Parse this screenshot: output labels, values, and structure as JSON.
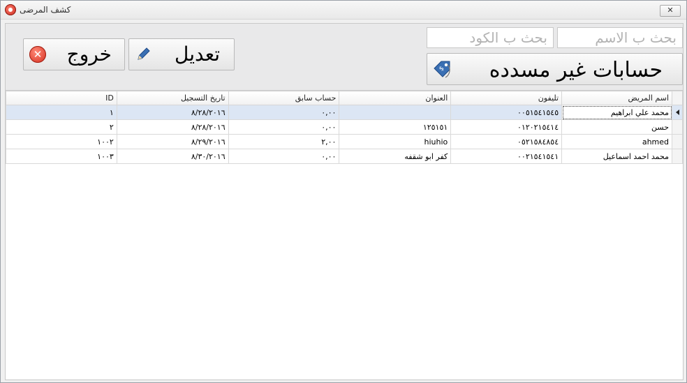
{
  "window": {
    "title": "كشف المرضى",
    "close_label": "✕"
  },
  "search": {
    "name_placeholder": "بحث ب الاسم",
    "code_placeholder": "بحث ب الكود"
  },
  "buttons": {
    "unpaid_label": "حسابات غير مسدده",
    "edit_label": "تعديل",
    "exit_label": "خروج",
    "exit_icon_glyph": "✕"
  },
  "table": {
    "columns": [
      "اسم المريض",
      "تليفون",
      "العنوان",
      "حساب سابق",
      "تاريخ التسجيل",
      "ID"
    ],
    "rows": [
      {
        "name": "محمد علي ابراهيم",
        "phone": "٠٠٥١٥٤١٥٤٥",
        "address": "",
        "balance": "٠,٠٠",
        "date": "٨/٢٨/٢٠١٦",
        "id": "١"
      },
      {
        "name": "حسن",
        "phone": "٠١٢٠٢١٥٤١٤",
        "address": "١٢٥١٥١",
        "balance": "٠,٠٠",
        "date": "٨/٢٨/٢٠١٦",
        "id": "٢"
      },
      {
        "name": "ahmed",
        "phone": "٠٥٢١٥٨٤٨٥٤",
        "address": "hiuhio",
        "balance": "٢,٠٠",
        "date": "٨/٢٩/٢٠١٦",
        "id": "١٠٠٢"
      },
      {
        "name": "محمد احمد اسماعيل",
        "phone": "٠٠٢١٥٤١٥٤١",
        "address": "كفر ابو شقفه",
        "balance": "٠,٠٠",
        "date": "٨/٣٠/٢٠١٦",
        "id": "١٠٠٣"
      }
    ]
  },
  "colors": {
    "selected_row": "#dce6f4",
    "exit_red": "#d42b1c",
    "icon_blue": "#3a6fb3"
  }
}
